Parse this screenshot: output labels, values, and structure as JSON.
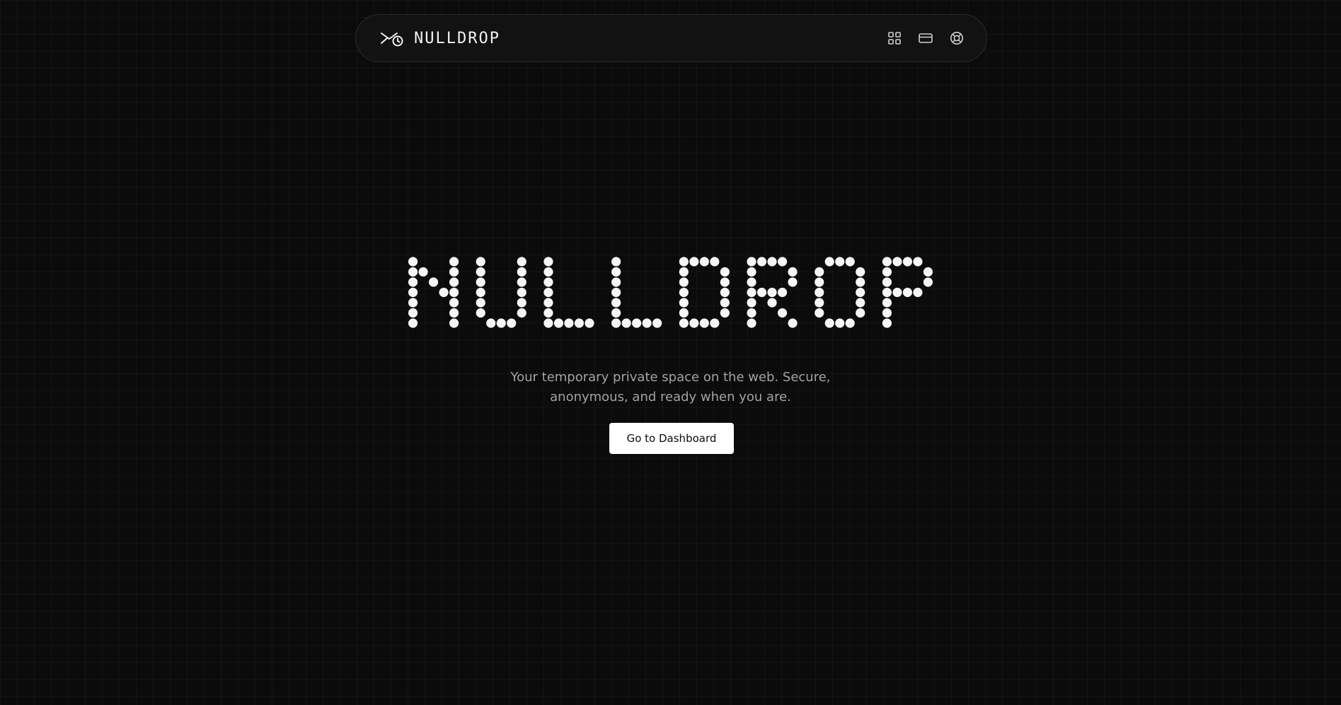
{
  "header": {
    "brand_name": "NULLDROP",
    "brand_icon": "mail-clock-icon",
    "nav_icons": [
      "grid-icon",
      "card-icon",
      "lifebuoy-icon"
    ]
  },
  "hero": {
    "title": "NULLDROP",
    "tagline_line1": "Your temporary private space on the web. Secure,",
    "tagline_line2": "anonymous, and ready when you are.",
    "cta_label": "Go to Dashboard"
  },
  "colors": {
    "background": "#0b0b0b",
    "navbar_bg": "#121212",
    "dot": "#f5f5f5",
    "tagline": "#a3a3a3",
    "button_bg": "#ffffff",
    "button_text": "#0b0b0b"
  }
}
